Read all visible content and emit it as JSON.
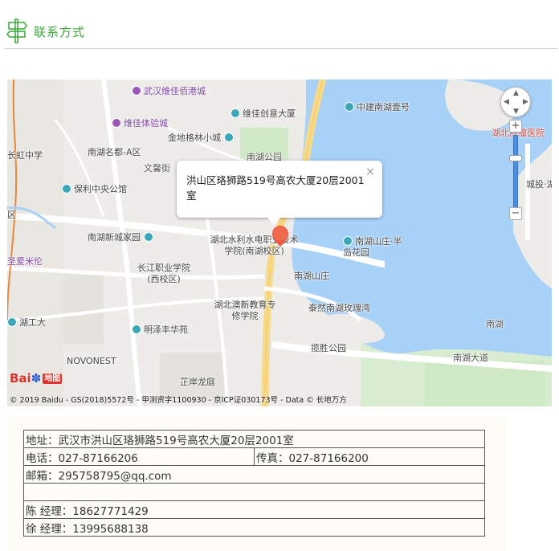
{
  "section": {
    "title": "联系方式",
    "icon": "signpost-icon",
    "accent_color": "#3aa83a"
  },
  "map": {
    "popup_address": "洪山区珞狮路519号高农大厦20层2001室",
    "close_symbol": "×",
    "logo_text_1": "Bai",
    "logo_text_2": "地图",
    "copyright": "© 2019 Baidu - GS(2018)5572号 - 甲测资字1100930 - 京ICP证030173号 - Data © 长地万方",
    "zoom_in": "+",
    "zoom_out": "−",
    "labels": {
      "p1": "武汉维佳佰港城",
      "p2": "维佳创意大厦",
      "p3": "中建南湖壹号",
      "p4": "维佳体验城",
      "p5": "金地格林小城",
      "p6": "南湖名都-A区",
      "p7": "南湖公园",
      "p8": "长虹中学",
      "p9": "文馨街",
      "p10": "保利中央公馆",
      "p11": "南湖新城家园",
      "p12": "湖北水利水电职业技术学院(南湖校区)",
      "p13": "南湖山庄·半岛花园",
      "p14": "长江职业学院(西校区)",
      "p15": "南湖山庄",
      "p16": "湖北澳新教育专修学院",
      "p17": "泰然南湖玫瑰湾",
      "p18": "明泽丰华苑",
      "p19": "湖工大",
      "p20": "揽胜公园",
      "p21": "南湖",
      "p22": "NOVONEST",
      "p23": "南湖大道",
      "p24": "芷岸龙庭",
      "p25": "湖北肿瘤医院",
      "p26": "城投·湖",
      "p27": "圣爱米伦",
      "p28": "区"
    }
  },
  "contact": {
    "address": "地址：武汉市洪山区珞狮路519号高农大厦20层2001室",
    "phone": "电话：027-87166206",
    "fax": "传真：027-87166200",
    "email": "邮箱：295758795@qq.com",
    "blank": "",
    "manager1": "陈 经理：18627771429",
    "manager2": "徐 经理：13995688138"
  }
}
